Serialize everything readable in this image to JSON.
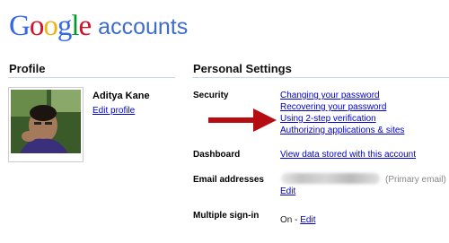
{
  "header": {
    "logo_letters": [
      "G",
      "o",
      "o",
      "g",
      "l",
      "e"
    ],
    "logo_colors": [
      "#3369e8",
      "#d50f25",
      "#eeb211",
      "#3369e8",
      "#009925",
      "#d50f25"
    ],
    "logo_subtitle": "accounts"
  },
  "profile": {
    "title": "Profile",
    "name": "Aditya Kane",
    "edit_label": "Edit profile"
  },
  "personal_settings": {
    "title": "Personal Settings",
    "security": {
      "label": "Security",
      "links": [
        "Changing your password",
        "Recovering your password",
        "Using 2-step verification",
        "Authorizing applications & sites"
      ]
    },
    "dashboard": {
      "label": "Dashboard",
      "link": "View data stored with this account"
    },
    "email": {
      "label": "Email addresses",
      "primary_note": "(Primary email)",
      "edit_label": "Edit"
    },
    "multiple_signin": {
      "label": "Multiple sign-in",
      "status": "On - ",
      "edit_label": "Edit"
    }
  },
  "colors": {
    "link": "#0000cc",
    "arrow": "#b50d12",
    "rule": "#c5d7ef",
    "subtitle": "#3d6dc9"
  },
  "icons": {
    "arrow": "right-pointing-red-arrow-icon"
  }
}
